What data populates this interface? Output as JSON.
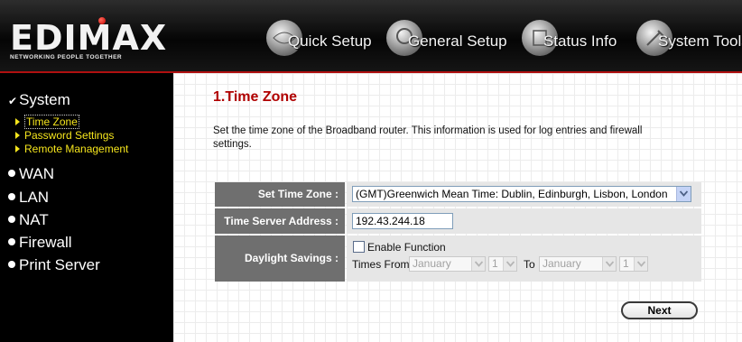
{
  "header": {
    "logo_text": "EDIMAX",
    "logo_tagline": "NETWORKING PEOPLE TOGETHER",
    "nav": [
      {
        "label": "Quick Setup",
        "icon": "globe-icon"
      },
      {
        "label": "General Setup",
        "icon": "gears-icon"
      },
      {
        "label": "Status Info",
        "icon": "status-icon"
      },
      {
        "label": "System Tools",
        "icon": "tools-icon"
      }
    ]
  },
  "sidebar": {
    "system_label": "System",
    "system_subitems": [
      {
        "label": "Time Zone",
        "selected": true
      },
      {
        "label": "Password Settings",
        "selected": false
      },
      {
        "label": "Remote Management",
        "selected": false
      }
    ],
    "items": [
      {
        "label": "WAN"
      },
      {
        "label": "LAN"
      },
      {
        "label": "NAT"
      },
      {
        "label": "Firewall"
      },
      {
        "label": "Print Server"
      }
    ]
  },
  "main": {
    "title": "1.Time Zone",
    "description": "Set the time zone of the Broadband router. This information is used for log entries and firewall settings.",
    "fields": {
      "time_zone_label": "Set Time Zone :",
      "time_zone_value": "(GMT)Greenwich Mean Time: Dublin, Edinburgh, Lisbon, London",
      "time_server_label": "Time Server Address :",
      "time_server_value": "192.43.244.18",
      "daylight_label": "Daylight Savings :",
      "enable_label": "Enable Function",
      "enable_checked": false,
      "times_from_label": "Times From",
      "from_month": "January",
      "from_day": "1",
      "to_label": "To",
      "to_month": "January",
      "to_day": "1"
    },
    "next_label": "Next"
  },
  "colors": {
    "title_red": "#b00000",
    "sidebar_sub_yellow": "#f5e51d",
    "label_gray": "#6f6f6f"
  }
}
